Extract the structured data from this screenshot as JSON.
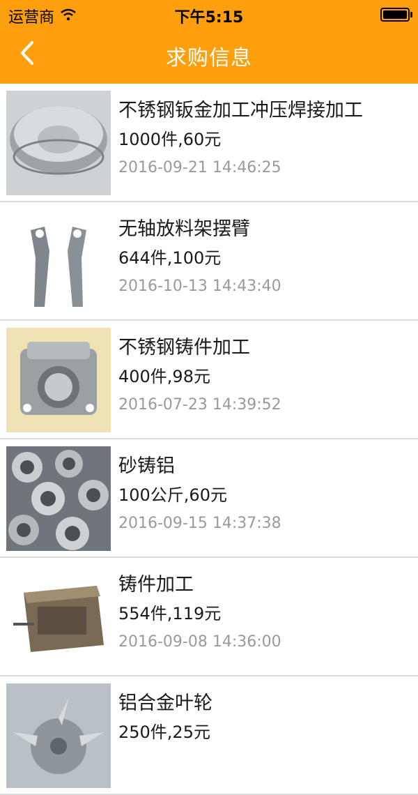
{
  "status_bar": {
    "carrier": "运营商",
    "time": "下午5:15"
  },
  "nav": {
    "title": "求购信息"
  },
  "items": [
    {
      "title": "不锈钢钣金加工冲压焊接加工",
      "qty": "1000件,60元",
      "date": "2016-09-21 14:46:25",
      "image": "stainless-ring-photo"
    },
    {
      "title": "无轴放料架摆臂",
      "qty": "644件,100元",
      "date": "2016-10-13 14:43:40",
      "image": "swing-arm-photo"
    },
    {
      "title": "不锈钢铸件加工",
      "qty": "400件,98元",
      "date": "2016-07-23 14:39:52",
      "image": "casting-block-photo"
    },
    {
      "title": "砂铸铝",
      "qty": "100公斤,60元",
      "date": "2016-09-15 14:37:38",
      "image": "aluminum-parts-photo"
    },
    {
      "title": "铸件加工",
      "qty": "554件,119元",
      "date": "2016-09-08 14:36:00",
      "image": "cast-box-photo"
    },
    {
      "title": "铝合金叶轮",
      "qty": "250件,25元",
      "date": "",
      "image": "impeller-photo"
    }
  ]
}
